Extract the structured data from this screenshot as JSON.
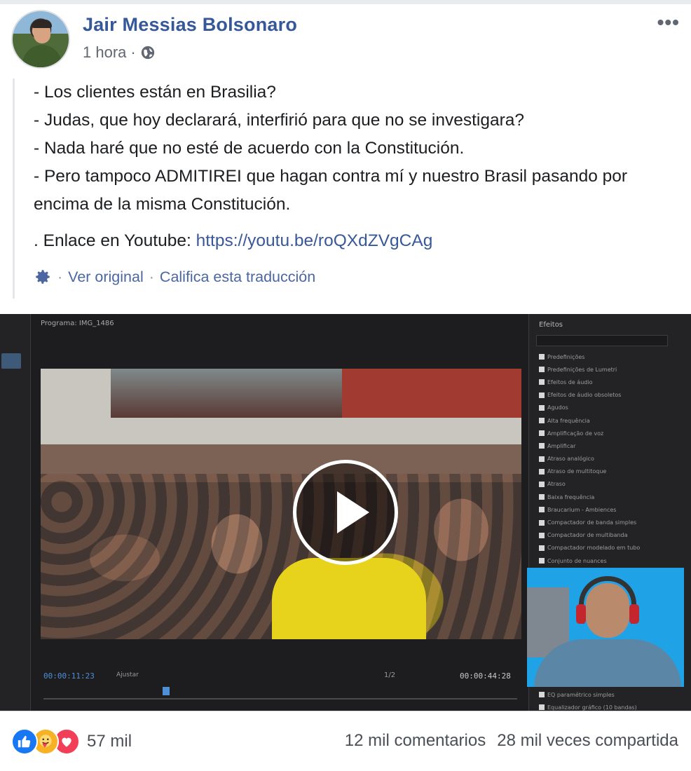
{
  "post": {
    "author": "Jair Messias Bolsonaro",
    "time": "1 hora",
    "separator": "·",
    "privacy_icon": "globe-icon",
    "menu_icon": "more-options-icon",
    "more_label": "•••",
    "lines": [
      "- Los clientes están en Brasilia?",
      "- Judas, que hoy declarará, interfirió para que no se investigara?",
      "- Nada haré que no esté de acuerdo con la Constitución.",
      "- Pero tampoco ADMITIREI que hagan contra mí y nuestro Brasil pasando por encima de la misma Constitución."
    ],
    "link_prefix": ". Enlace en Youtube: ",
    "link_url": "https://youtu.be/roQXdZVgCAg",
    "translation": {
      "icon": "gear-icon",
      "sep1": "·",
      "see_original": "Ver original",
      "sep2": "·",
      "rate": "Califica esta traducción"
    }
  },
  "video": {
    "panel_title": "Programa: IMG_1486",
    "timecode_current": "00:00:11:23",
    "fit_label": "Ajustar",
    "ratio_label": "1/2",
    "timecode_total": "00:00:44:28",
    "effects_title": "Efeitos",
    "effects_items": [
      "Predefinições",
      "Predefinições de Lumetri",
      "Efeitos de áudio",
      "Efeitos de áudio obsoletos",
      "Agudos",
      "Alta frequência",
      "Amplificação de voz",
      "Amplificar",
      "Atraso analógico",
      "Atraso de multitoque",
      "Atraso",
      "Baixa frequência",
      "Braucarium - Ambiences",
      "Compactador de banda simples",
      "Compactador de multibanda",
      "Compactador modelado em tubo",
      "Conjunto de nuances"
    ],
    "effects_bottom": [
      "EQ paramétrico simples",
      "Equalizador gráfico (10 bandas)"
    ],
    "play_icon": "play-icon"
  },
  "footer": {
    "reactions": [
      "like-icon",
      "care-icon",
      "love-icon"
    ],
    "reaction_count": "57 mil",
    "comments": "12 mil comentarios",
    "shares": "28 mil veces compartida"
  },
  "colors": {
    "author_blue": "#365899",
    "link_blue": "#385898",
    "like_blue": "#1877f2",
    "love_red": "#f33e58",
    "care_yellow": "#f7b125"
  }
}
